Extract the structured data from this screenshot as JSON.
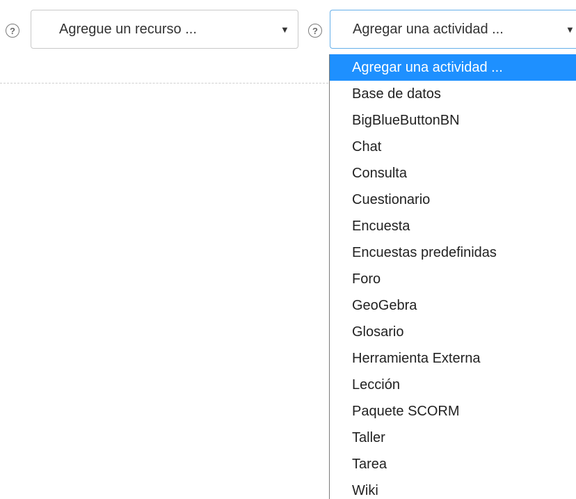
{
  "resource_select": {
    "value": "Agregue un recurso ...",
    "arrow": "▼",
    "help_icon": "question-circle-icon",
    "help_glyph": "?"
  },
  "activity_select": {
    "value": "Agregar una actividad ...",
    "arrow": "▼",
    "help_icon": "question-circle-icon",
    "help_glyph": "?",
    "options": [
      "Agregar una actividad ...",
      "Base de datos",
      "BigBlueButtonBN",
      "Chat",
      "Consulta",
      "Cuestionario",
      "Encuesta",
      "Encuestas predefinidas",
      "Foro",
      "GeoGebra",
      "Glosario",
      "Herramienta Externa",
      "Lección",
      "Paquete SCORM",
      "Taller",
      "Tarea",
      "Wiki"
    ],
    "selected_index": 0
  },
  "colors": {
    "highlight": "#1e90ff",
    "focus_border": "#66afe9",
    "text": "#333333"
  }
}
